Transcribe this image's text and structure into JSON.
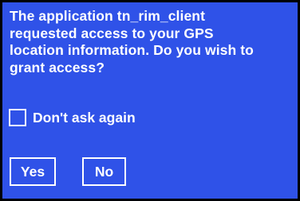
{
  "dialog": {
    "message_lines": [
      "The application tn_rim_client",
      "requested access to your GPS",
      "location information.  Do you wish to",
      "grant access?"
    ],
    "checkbox_label": "Don't ask again",
    "checkbox_checked": false,
    "yes_label": "Yes",
    "no_label": "No"
  },
  "colors": {
    "background": "#2f52e8",
    "text": "#ffffff",
    "border": "#000000"
  }
}
